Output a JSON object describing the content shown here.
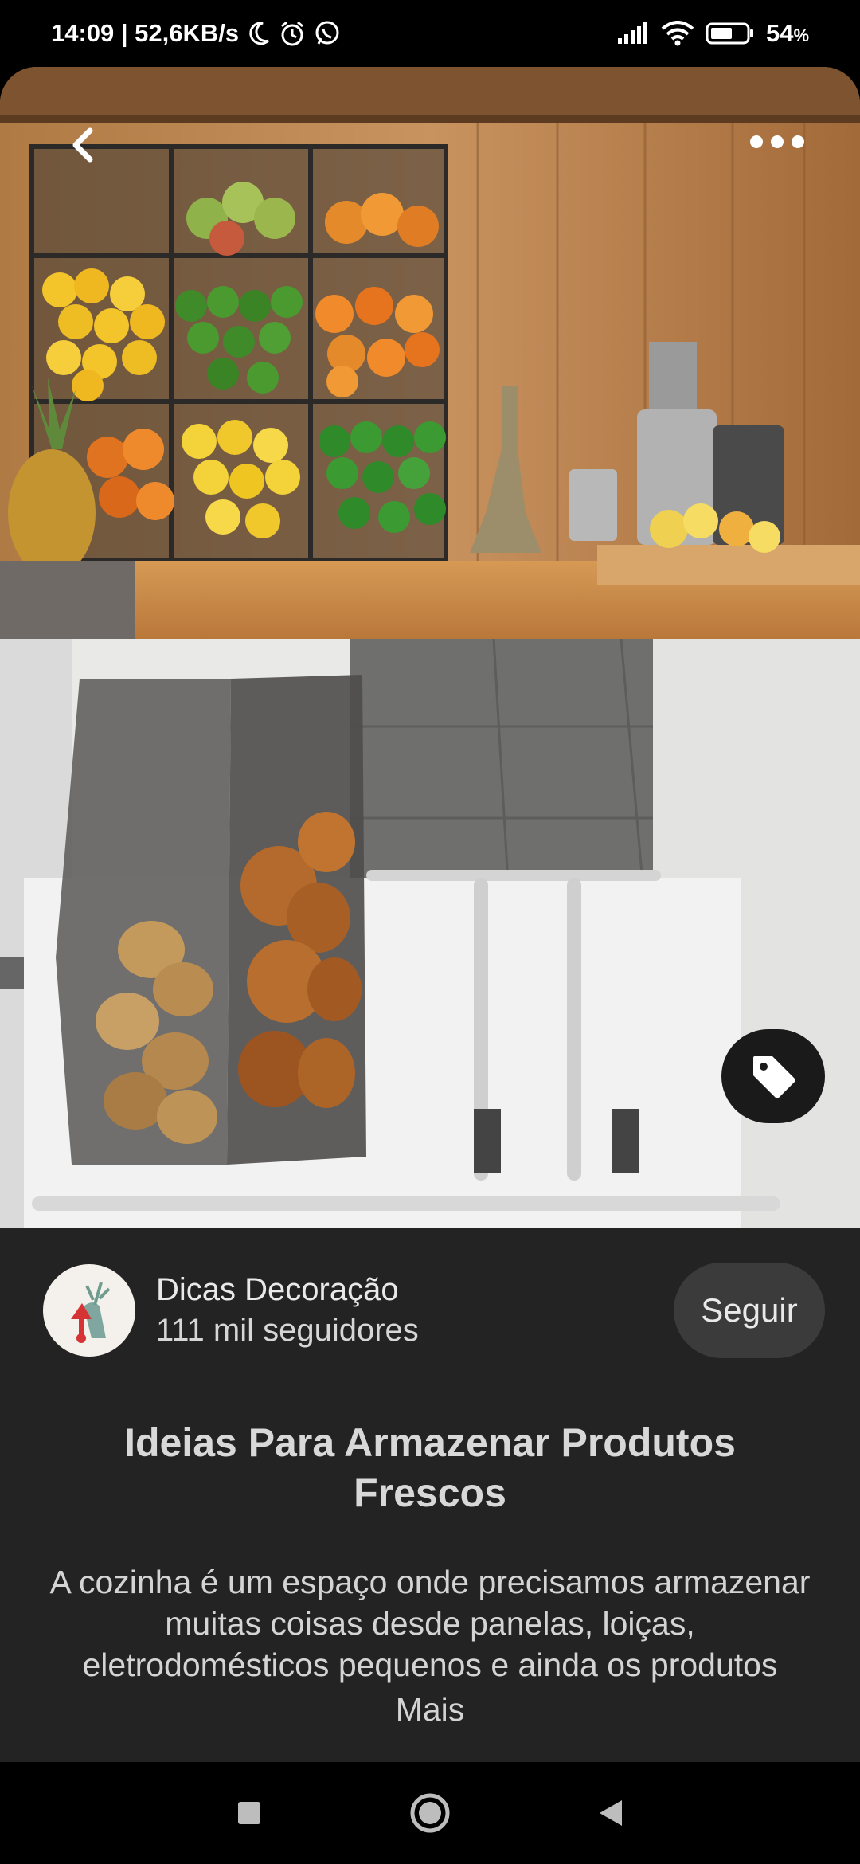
{
  "status_bar": {
    "time_speed": "14:09 | 52,6KB/s",
    "battery_pct": "54",
    "battery_unit": "%",
    "icons": [
      "moon-icon",
      "alarm-icon",
      "whatsapp-icon",
      "signal-icon",
      "wifi-icon",
      "battery-icon"
    ]
  },
  "pin": {
    "creator_name": "Dicas Decoração",
    "creator_followers": "111 mil seguidores",
    "follow_label": "Seguir",
    "title": "Ideias Para Armazenar Produtos Frescos",
    "description": "A cozinha é um espaço onde precisamos armazenar muitas coisas desde panelas, loiças, eletrodomésticos pequenos e ainda os produtos",
    "more_label": "Mais"
  },
  "nav": {
    "icons": [
      "recents-square-icon",
      "home-circle-icon",
      "back-triangle-icon"
    ]
  },
  "colors": {
    "background": "#000000",
    "info_panel": "#232323",
    "follow_button": "#3b3b3b",
    "text": "#e6e6e6"
  }
}
